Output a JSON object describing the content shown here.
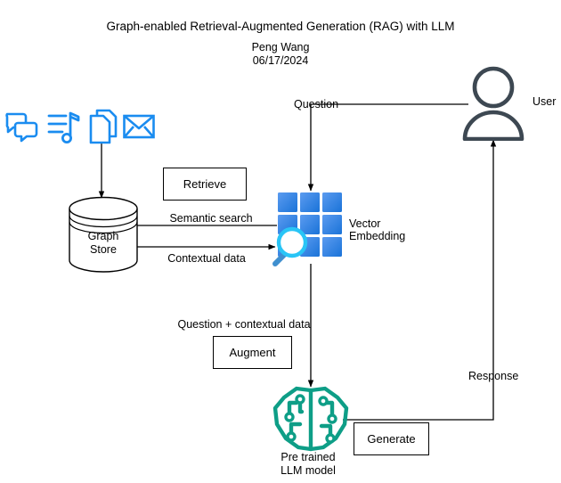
{
  "header": {
    "title": "Graph-enabled Retrieval-Augmented Generation (RAG) with LLM",
    "author": "Peng Wang",
    "date": "06/17/2024"
  },
  "sources": {
    "icons": [
      {
        "name": "chat-bubbles-icon",
        "label": "chat"
      },
      {
        "name": "music-note-icon",
        "label": "music"
      },
      {
        "name": "documents-icon",
        "label": "documents"
      },
      {
        "name": "envelope-icon",
        "label": "email"
      }
    ],
    "color": "#1a8cf0"
  },
  "nodes": {
    "graph_store": {
      "label_line1": "Graph",
      "label_line2": "Store"
    },
    "vector_embedding": {
      "label_line1": "Vector",
      "label_line2": "Embedding",
      "tile_light": "#5b9bf0",
      "tile_dark": "#1a73d8",
      "magnifier": "#29c5f6"
    },
    "llm": {
      "label_line1": "Pre trained",
      "label_line2": "LLM model",
      "color": "#0e9e87"
    },
    "user": {
      "label": "User",
      "color": "#3d4852"
    }
  },
  "steps": {
    "retrieve": "Retrieve",
    "augment": "Augment",
    "generate": "Generate"
  },
  "edges": {
    "question": "Question",
    "semantic_search": "Semantic search",
    "contextual_data": "Contextual data",
    "question_plus_contextual": "Question + contextual data",
    "response": "Response"
  }
}
